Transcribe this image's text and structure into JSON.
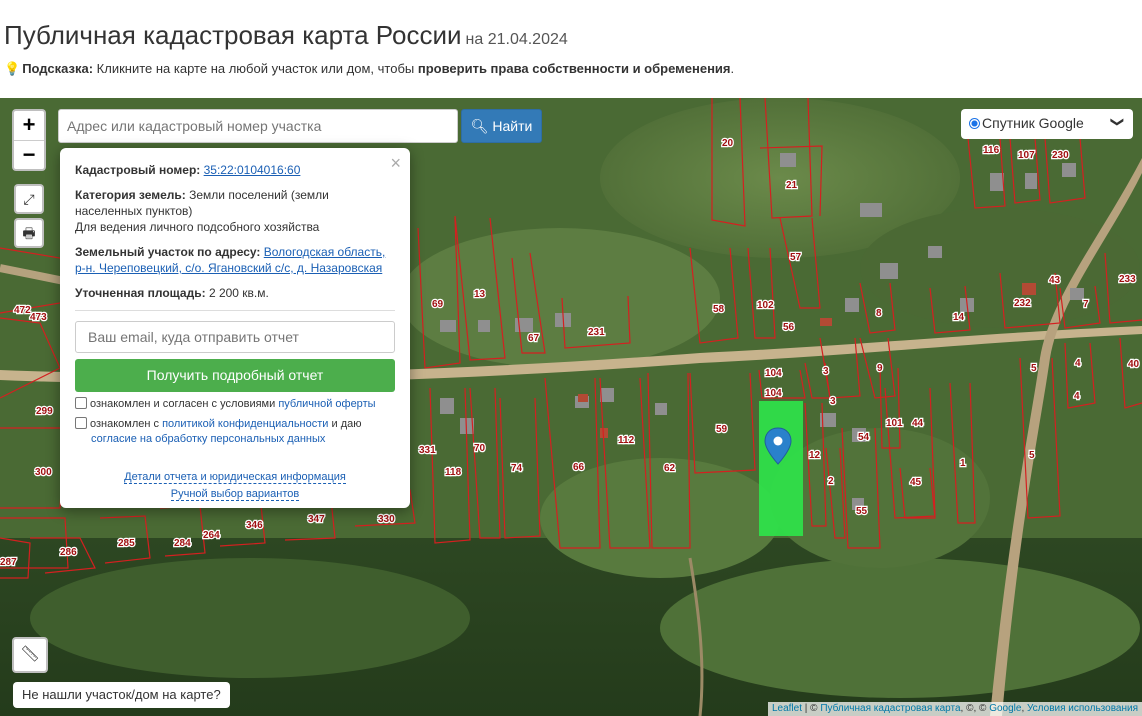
{
  "header": {
    "title": "Публичная кадастровая карта России",
    "date": "на 21.04.2024",
    "hint_label": "Подсказка:",
    "hint_text": "Кликните на карте на любой участок или дом, чтобы",
    "hint_bold": "проверить права собственности и обременения",
    "hint_end": "."
  },
  "map": {
    "zoom_in": "+",
    "zoom_out": "−",
    "search_placeholder": "Адрес или кадастровый номер участка",
    "find_button": "Найти",
    "layer_select": "Спутник Google",
    "not_found_button": "Не нашли участок/дом на карте?",
    "attribution": {
      "leaflet": "Leaflet",
      "sep1": " | © ",
      "pkk": "Публичная кадастровая карта",
      "sep2": ", ©, © ",
      "google": "Google",
      "sep3": ", ",
      "terms": "Условия использования"
    },
    "parcel_labels": [
      "20",
      "21",
      "116",
      "107",
      "230",
      "57",
      "233",
      "472",
      "473",
      "69",
      "13",
      "67",
      "231",
      "58",
      "102",
      "56",
      "8",
      "14",
      "232",
      "43",
      "7",
      "4",
      "40",
      "299",
      "104",
      "104",
      "3",
      "9",
      "5",
      "3",
      "101",
      "44",
      "54",
      "4",
      "5",
      "331",
      "70",
      "118",
      "74",
      "66",
      "112",
      "62",
      "59",
      "12",
      "1",
      "45",
      "2",
      "55",
      "300",
      "347",
      "330",
      "346",
      "284",
      "264",
      "285",
      "286",
      "287"
    ],
    "highlight_color": "#2ee64a",
    "marker_color": "#2a81cb"
  },
  "popup": {
    "cadastral_label": "Кадастровый номер:",
    "cadastral_number": "35:22:0104016:60",
    "category_label": "Категория земель:",
    "category_value": "Земли поселений (земли населенных пунктов)",
    "usage": "Для ведения личного подсобного хозяйства",
    "address_label": "Земельный участок по адресу:",
    "address_value": "Вологодская область, р-н. Череповецкий, с/о. Ягановский с/с, д. Назаровская",
    "area_label": "Уточненная площадь:",
    "area_value": "2 200 кв.м.",
    "email_placeholder": "Ваш email, куда отправить отчет",
    "report_button": "Получить подробный отчет",
    "check1_text": "ознакомлен и согласен с условиями",
    "check1_link": "публичной оферты",
    "check2_text": "ознакомлен с",
    "check2_link1": "политикой конфиденциальности",
    "check2_mid": "и даю",
    "check2_link2": "согласие на обработку персональных данных",
    "details_link": "Детали отчета и юридическая информация",
    "manual_link": "Ручной выбор вариантов",
    "close": "×"
  }
}
